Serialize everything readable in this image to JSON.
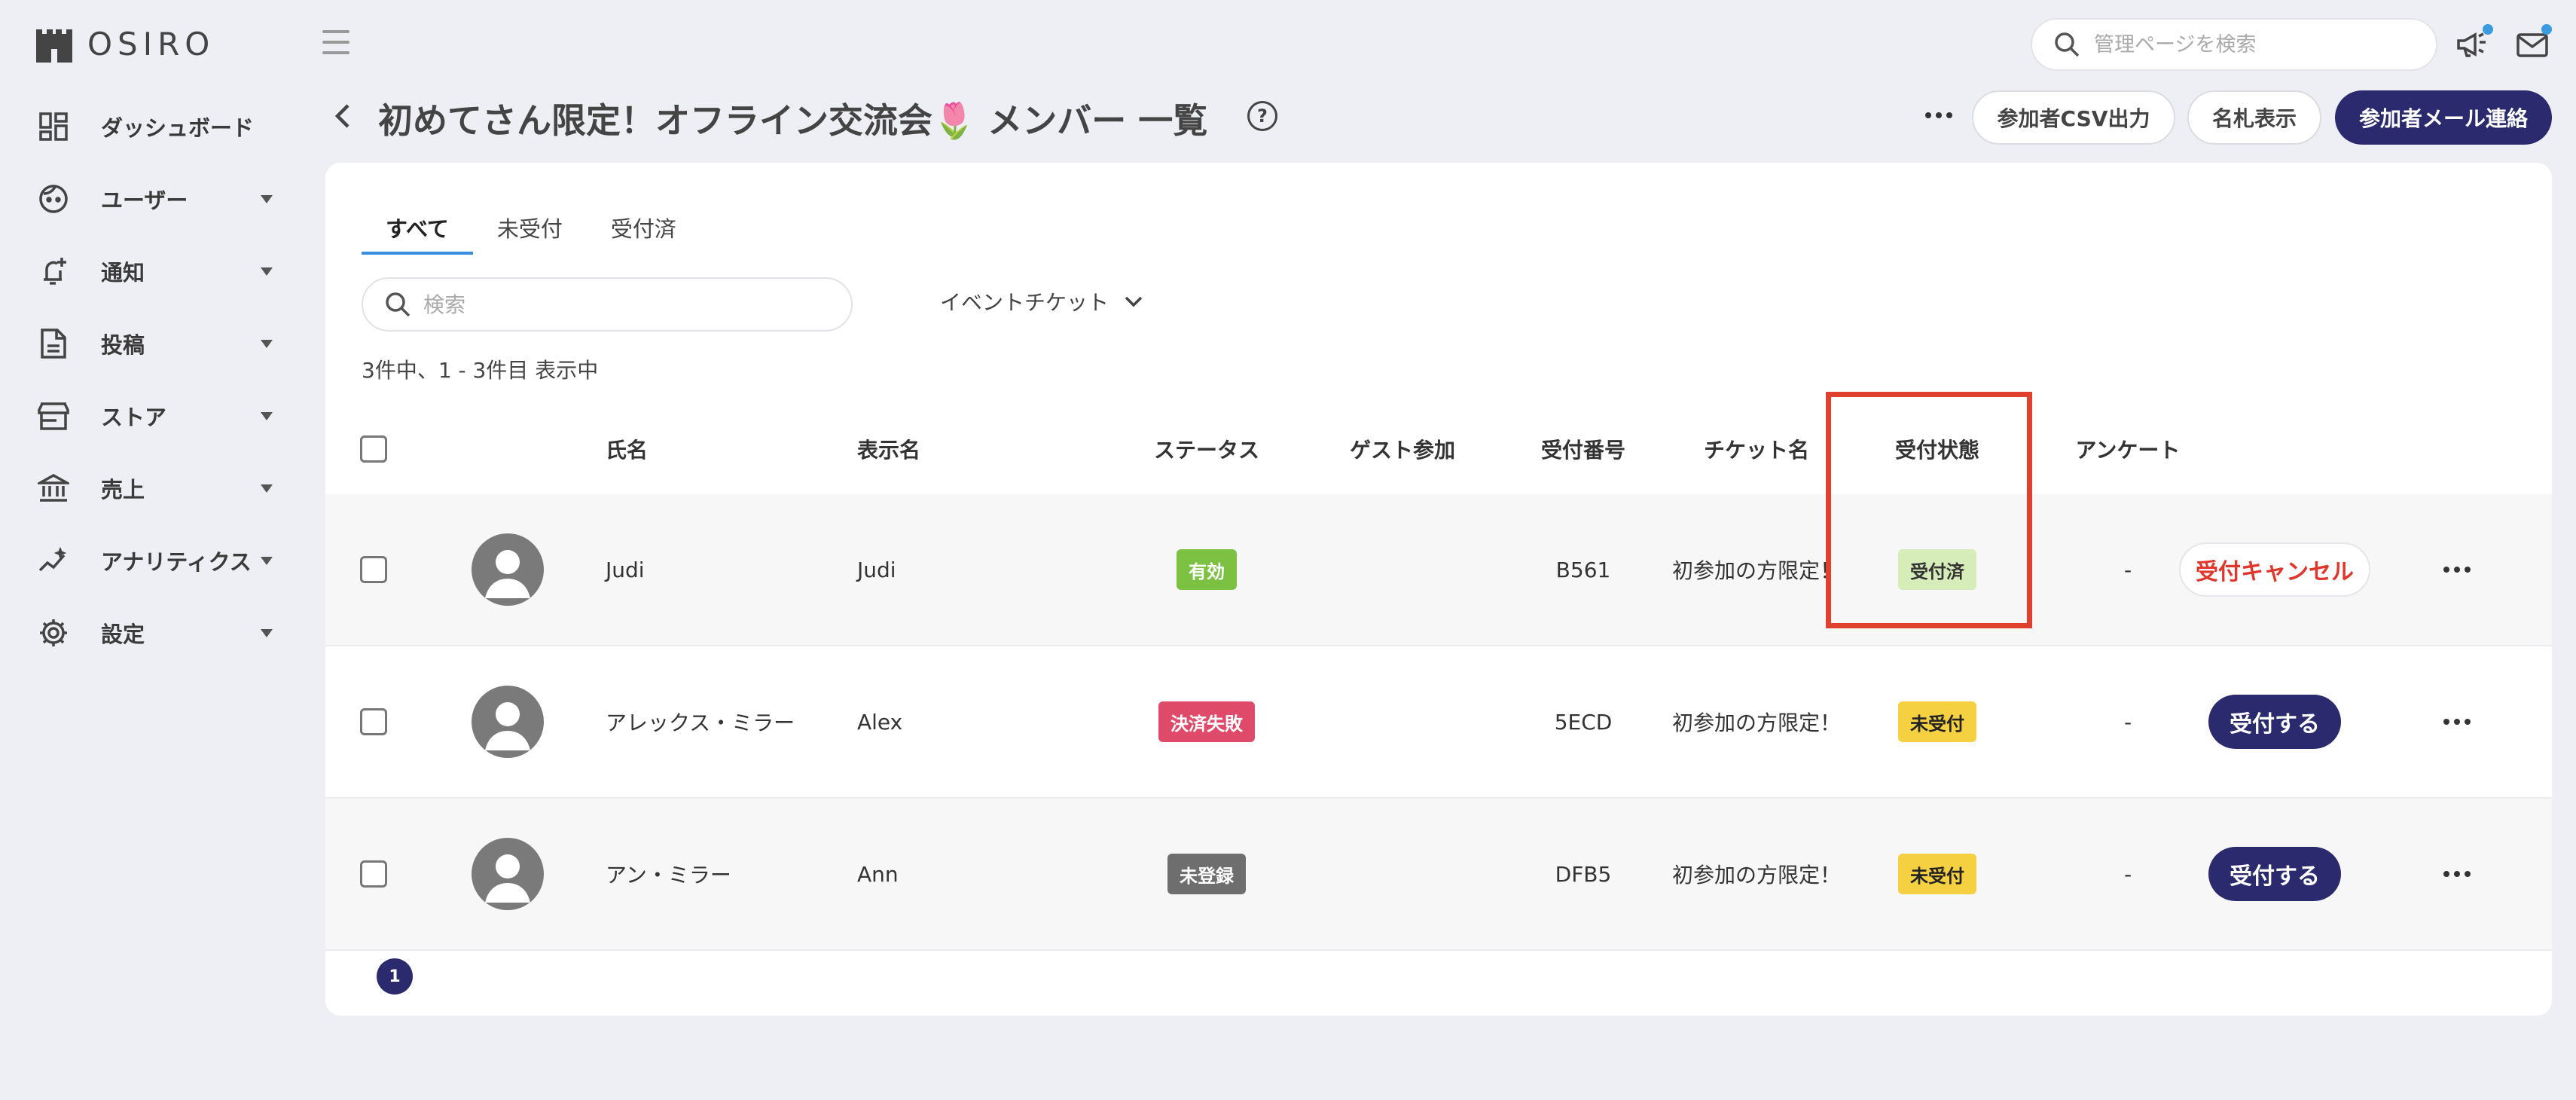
{
  "app": {
    "logo_text": "OSIRO"
  },
  "sidebar": {
    "items": [
      {
        "label": "ダッシュボード",
        "icon": "dashboard-icon",
        "has_caret": false
      },
      {
        "label": "ユーザー",
        "icon": "user-face-icon",
        "has_caret": true
      },
      {
        "label": "通知",
        "icon": "bell-add-icon",
        "has_caret": true
      },
      {
        "label": "投稿",
        "icon": "document-icon",
        "has_caret": true
      },
      {
        "label": "ストア",
        "icon": "store-icon",
        "has_caret": true
      },
      {
        "label": "売上",
        "icon": "bank-icon",
        "has_caret": true
      },
      {
        "label": "アナリティクス",
        "icon": "analytics-icon",
        "has_caret": true
      },
      {
        "label": "設定",
        "icon": "gear-icon",
        "has_caret": true
      }
    ]
  },
  "topbar": {
    "search_placeholder": "管理ページを検索",
    "announce_icon": "megaphone-icon",
    "mail_icon": "mail-icon"
  },
  "header": {
    "title": "初めてさん限定！オフライン交流会🌷 メンバー 一覧",
    "help": "?",
    "buttons": {
      "csv": "参加者CSV出力",
      "namecard": "名札表示",
      "mail": "参加者メール連絡"
    }
  },
  "tabs": [
    {
      "label": "すべて",
      "active": true
    },
    {
      "label": "未受付",
      "active": false
    },
    {
      "label": "受付済",
      "active": false
    }
  ],
  "list": {
    "search_placeholder": "検索",
    "filter_label": "イベントチケット",
    "count_text": "3件中、1 - 3件目 表示中"
  },
  "table": {
    "columns": {
      "name": "氏名",
      "display_name": "表示名",
      "status": "ステータス",
      "guest": "ゲスト参加",
      "reception_no": "受付番号",
      "ticket": "チケット名",
      "reception_state": "受付状態",
      "survey": "アンケート"
    },
    "rows": [
      {
        "name": "Judi",
        "display_name": "Judi",
        "status": "有効",
        "status_color": "#7cc142",
        "guest": "",
        "reception_no": "B561",
        "ticket": "初参加の方限定！",
        "reception_state": "受付済",
        "state_color": "#d6ecb9",
        "survey": "-",
        "action": "受付キャンセル",
        "action_type": "cancel"
      },
      {
        "name": "アレックス・ミラー",
        "display_name": "Alex",
        "status": "決済失敗",
        "status_color": "#e04a6a",
        "guest": "",
        "reception_no": "5ECD",
        "ticket": "初参加の方限定！",
        "reception_state": "未受付",
        "state_color": "#f5d142",
        "survey": "-",
        "action": "受付する",
        "action_type": "accept"
      },
      {
        "name": "アン・ミラー",
        "display_name": "Ann",
        "status": "未登録",
        "status_color": "#6e6e6e",
        "guest": "",
        "reception_no": "DFB5",
        "ticket": "初参加の方限定！",
        "reception_state": "未受付",
        "state_color": "#f5d142",
        "survey": "-",
        "action": "受付する",
        "action_type": "accept"
      }
    ]
  },
  "pagination": {
    "current": "1"
  },
  "colors": {
    "accent": "#2b2a6e",
    "highlight": "#e0402e",
    "tab_underline": "#3a8ee0"
  }
}
